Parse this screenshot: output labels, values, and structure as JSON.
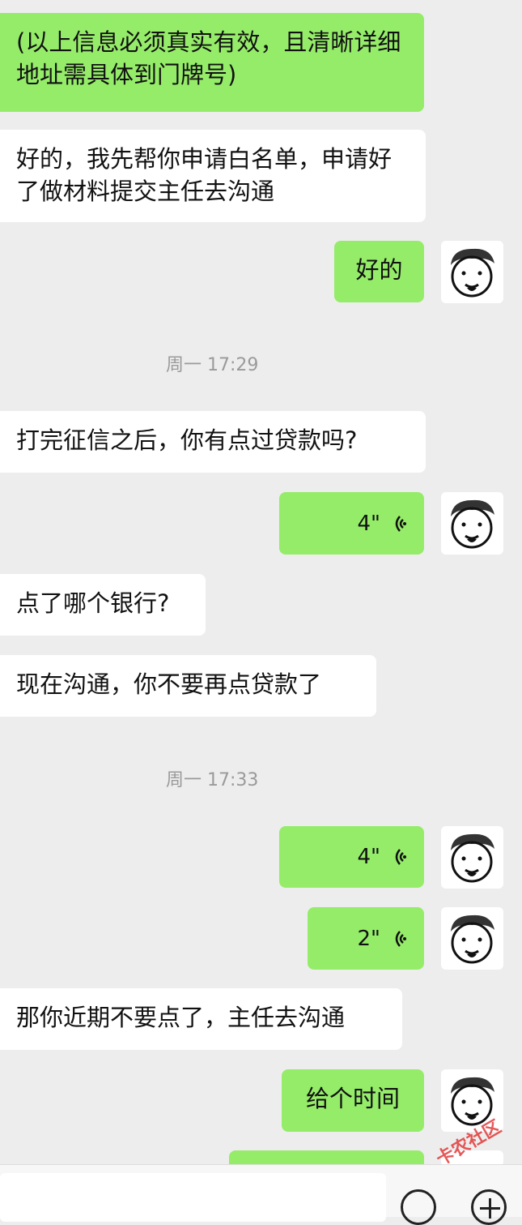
{
  "messages": [
    {
      "side": "out",
      "text": "(以上信息必须真实有效，且清晰详细地址需具体到门牌号)"
    },
    {
      "side": "in",
      "text": "好的，我先帮你申请白名单，申请好了做材料提交主任去沟通"
    },
    {
      "side": "out",
      "text": "好的"
    },
    {
      "time": "周一 17:29"
    },
    {
      "side": "in",
      "text": "打完征信之后，你有点过贷款吗?"
    },
    {
      "side": "out",
      "voice": "4\""
    },
    {
      "side": "in",
      "text": "点了哪个银行?"
    },
    {
      "side": "in",
      "text": "现在沟通，你不要再点贷款了"
    },
    {
      "time": "周一 17:33"
    },
    {
      "side": "out",
      "voice": "4\""
    },
    {
      "side": "out",
      "voice": "2\""
    },
    {
      "side": "in",
      "text": "那你近期不要点了，主任去沟通"
    },
    {
      "side": "out",
      "text": "给个时间"
    }
  ],
  "icons": {
    "voice": "voice-wave-icon",
    "emoji": "emoji-icon",
    "plus": "plus-icon"
  },
  "colors": {
    "outgoing_bubble": "#95ec69",
    "incoming_bubble": "#ffffff",
    "background": "#ededed"
  },
  "watermark": "卡农社区"
}
